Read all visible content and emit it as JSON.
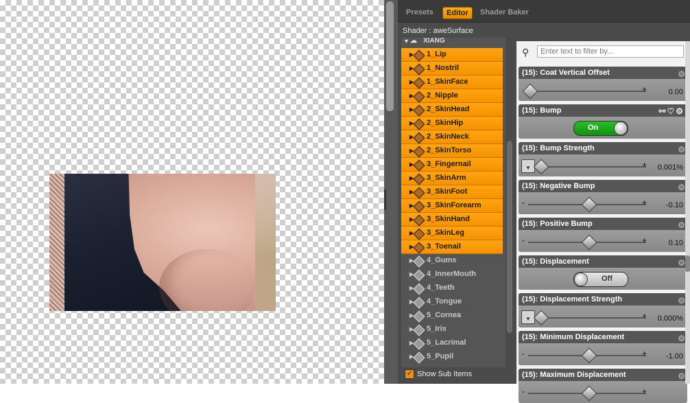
{
  "panel": {
    "tabs": [
      "Presets",
      "Editor",
      "Shader Baker"
    ],
    "active_tab": "Editor",
    "shader_line": "Shader : aweSurface"
  },
  "tree": {
    "root": "XIANG",
    "items": [
      {
        "label": "1_Lip",
        "selected": true
      },
      {
        "label": "1_Nostril",
        "selected": true
      },
      {
        "label": "1_SkinFace",
        "selected": true
      },
      {
        "label": "2_Nipple",
        "selected": true
      },
      {
        "label": "2_SkinHead",
        "selected": true
      },
      {
        "label": "2_SkinHip",
        "selected": true
      },
      {
        "label": "2_SkinNeck",
        "selected": true
      },
      {
        "label": "2_SkinTorso",
        "selected": true
      },
      {
        "label": "3_Fingernail",
        "selected": true
      },
      {
        "label": "3_SkinArm",
        "selected": true
      },
      {
        "label": "3_SkinFoot",
        "selected": true
      },
      {
        "label": "3_SkinForearm",
        "selected": true
      },
      {
        "label": "3_SkinHand",
        "selected": true
      },
      {
        "label": "3_SkinLeg",
        "selected": true
      },
      {
        "label": "3_Toenail",
        "selected": true
      },
      {
        "label": "4_Gums",
        "selected": false
      },
      {
        "label": "4_InnerMouth",
        "selected": false
      },
      {
        "label": "4_Teeth",
        "selected": false
      },
      {
        "label": "4_Tongue",
        "selected": false
      },
      {
        "label": "5_Cornea",
        "selected": false
      },
      {
        "label": "5_Iris",
        "selected": false
      },
      {
        "label": "5_Lacrimal",
        "selected": false
      },
      {
        "label": "5_Pupil",
        "selected": false
      }
    ],
    "show_sub_items": "Show Sub Items"
  },
  "filter": {
    "placeholder": "Enter text to filter by..."
  },
  "properties": [
    {
      "title": "(15): Coat Vertical Offset",
      "type": "slider",
      "value": "0.00",
      "knob": 0.0,
      "tex": false,
      "minus": false
    },
    {
      "title": "(15): Bump",
      "type": "toggle",
      "state": "On",
      "on": true,
      "icons": true
    },
    {
      "title": "(15): Bump Strength",
      "type": "slider",
      "value": "0.001%",
      "knob": 0.0,
      "tex": true,
      "minus": false
    },
    {
      "title": "(15): Negative Bump",
      "type": "slider",
      "value": "-0.10",
      "knob": 0.5,
      "tex": false,
      "minus": true
    },
    {
      "title": "(15): Positive Bump",
      "type": "slider",
      "value": "0.10",
      "knob": 0.5,
      "tex": false,
      "minus": true
    },
    {
      "title": "(15): Displacement",
      "type": "toggle",
      "state": "Off",
      "on": false,
      "icons": false
    },
    {
      "title": "(15): Displacement Strength",
      "type": "slider",
      "value": "0.000%",
      "knob": 0.0,
      "tex": true,
      "minus": false
    },
    {
      "title": "(15): Minimum Displacement",
      "type": "slider",
      "value": "-1.00",
      "knob": 0.5,
      "tex": false,
      "minus": true
    },
    {
      "title": "(15): Maximum Displacement",
      "type": "slider",
      "value": "",
      "knob": 0.5,
      "tex": false,
      "minus": true
    }
  ],
  "colors": {
    "accent": "#f59300",
    "toggle_on": "#1ea81e"
  }
}
